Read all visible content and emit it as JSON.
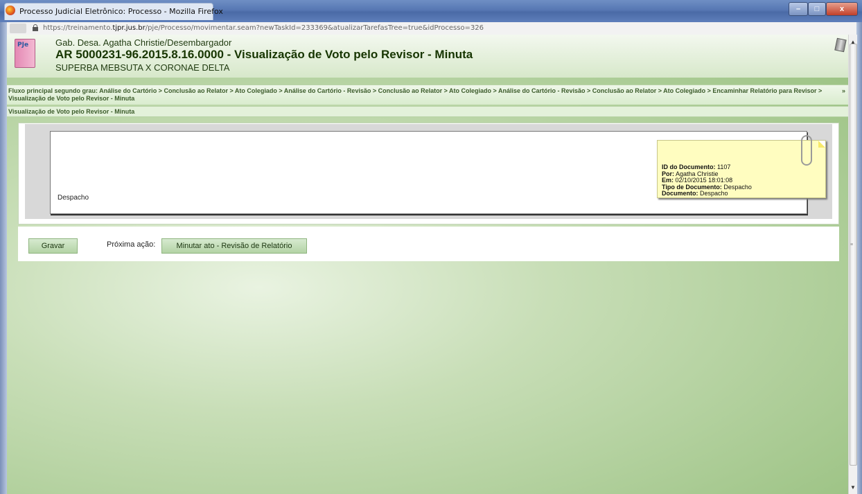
{
  "window": {
    "title": "Processo Judicial Eletrônico: Processo - Mozilla Firefox",
    "controls": {
      "minimize": "–",
      "maximize": "□",
      "close": "x"
    }
  },
  "url": {
    "prefix": "https://treinamento.",
    "domain": "tjpr.jus.br",
    "path": "/pje/Processo/movimentar.seam?newTaskId=233369&atualizarTarefasTree=true&idProcesso=326"
  },
  "header": {
    "logo": "PJe",
    "line1": "Gab. Desa. Agatha Christie/Desembargador",
    "line2": "AR 5000231-96.2015.8.16.0000 - Visualização de Voto pelo Revisor - Minuta",
    "line3": "SUPERBA MEBSUTA X CORONAE DELTA"
  },
  "breadcrumb": {
    "text": "Fluxo principal segundo grau: Análise do Cartório > Conclusão ao Relator > Ato Colegiado > Análise do Cartório - Revisão > Conclusão ao Relator > Ato Colegiado > Análise do Cartório - Revisão > Conclusão ao Relator > Ato Colegiado > Encaminhar Relatório para Revisor > Visualização de Voto pelo Revisor - Minuta",
    "more": "»"
  },
  "section": {
    "label": "Visualização de Voto pelo Revisor - Minuta"
  },
  "document": {
    "body_text": "Despacho",
    "note": {
      "id_label": "ID do Documento:",
      "id_value": "1107",
      "por_label": "Por:",
      "por_value": "Agatha Christie",
      "em_label": "Em:",
      "em_value": "02/10/2015 18:01:08",
      "tipo_label": "Tipo de Documento:",
      "tipo_value": "Despacho",
      "doc_label": "Documento:",
      "doc_value": "Despacho"
    }
  },
  "actions": {
    "gravar": "Gravar",
    "proxima_label": "Próxima ação:",
    "minutar": "Minutar ato - Revisão de Relatório"
  },
  "scrollbar": {
    "up": "▲",
    "grip": "≡",
    "down": "▼"
  }
}
